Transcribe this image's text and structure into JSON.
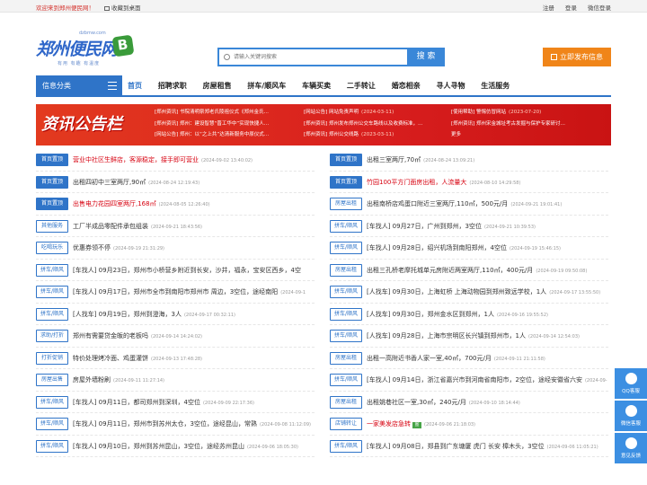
{
  "topbar": {
    "welcome": "欢迎来到郑州便民网！",
    "favorite": "收藏到桌面",
    "links": [
      "注册",
      "登录",
      "微信登录"
    ]
  },
  "logo": {
    "en": "dzbmw.com",
    "cn": "郑州便民网",
    "sub": "有用 有趣 有温度"
  },
  "search": {
    "placeholder": "请输入关键词搜索",
    "button": "搜 索"
  },
  "post_button": "立即发布信息",
  "nav": {
    "category": "信息分类",
    "items": [
      "首页",
      "招聘求职",
      "房屋租售",
      "拼车/顺风车",
      "车辆买卖",
      "二手转让",
      "婚恋相亲",
      "寻人寻物",
      "生活服务"
    ]
  },
  "notice": {
    "banner": "资讯公告栏",
    "col1": [
      {
        "t": "[郑州资讯] 书院清明祭郑老氏陵祖仪式《郑州金氏…",
        "d": ""
      },
      {
        "t": "[郑州资讯] 郑州：建设智慧“晋工华中”实现快捷人…",
        "d": ""
      },
      {
        "t": "[网站公告] 郑州：以“之上共”达清新服务中原仪式…",
        "d": ""
      }
    ],
    "col2": [
      {
        "t": "[网站公告] 网站免责声明",
        "d": "(2024-03-11)"
      },
      {
        "t": "[郑州资讯] 郑州发布郑州公交车路线以及收费标准，…",
        "d": ""
      },
      {
        "t": "[郑州资讯] 郑州公交线路",
        "d": "(2023-03-11)"
      }
    ],
    "col3": [
      {
        "t": "[使用帮助] 警惕仿冒网站",
        "d": "(2023-07-20)"
      },
      {
        "t": "[郑州资讯] 郑州宋金城址考古发掘与保护专家研讨…",
        "d": ""
      },
      {
        "t": "更多",
        "d": ""
      }
    ]
  },
  "left_list": [
    {
      "tag": "首页置顶",
      "top": true,
      "red": true,
      "text": "营业中社区生鲜店，客源稳定，接手即可营业",
      "date": "(2024-09-02 13:40:02)"
    },
    {
      "tag": "首页置顶",
      "top": true,
      "red": false,
      "text": "出租四初中三室两厅,90㎡",
      "date": "(2024-08-24 12:19:43)"
    },
    {
      "tag": "首页置顶",
      "top": true,
      "red": true,
      "text": "出售电力花园四室两厅,168㎡",
      "date": "(2024-08-05 12:26:40)"
    },
    {
      "tag": "其他服务",
      "top": false,
      "red": false,
      "text": "工厂半成品零配件承包组装",
      "date": "(2024-09-21 18:43:56)"
    },
    {
      "tag": "吃喝玩乐",
      "top": false,
      "red": false,
      "text": "优惠券领不停",
      "date": "(2024-09-19 21:31:29)"
    },
    {
      "tag": "拼车/顺风",
      "top": false,
      "red": false,
      "text": "[车找人] 09月23日，郑州市小桥营乡附近到长安，沙井，福永，宝安区西乡，4空",
      "date": ""
    },
    {
      "tag": "拼车/顺风",
      "top": false,
      "red": false,
      "text": "[车找人] 09月17日，郑州市全市到南阳市郑州市 周边，3空位，途经南阳",
      "date": "(2024-09-1"
    },
    {
      "tag": "拼车/顺风",
      "top": false,
      "red": false,
      "text": "[人找车] 09月19日，郑州到澄海，3人",
      "date": "(2024-09-17 00:32:11)"
    },
    {
      "tag": "求助/打折",
      "top": false,
      "red": false,
      "text": "郑州有需要贷金皈的老板吗",
      "date": "(2024-09-14 14:24:02)"
    },
    {
      "tag": "打折促销",
      "top": false,
      "red": false,
      "text": "特价处理烤冷面、鸡蛋灌饼",
      "date": "(2024-09-13 17:48:28)"
    },
    {
      "tag": "房屋出售",
      "top": false,
      "red": false,
      "text": "房屋外墙粉刷",
      "date": "(2024-09-11 11:27:14)"
    },
    {
      "tag": "拼车/顺风",
      "top": false,
      "red": false,
      "text": "[车找人] 09月11日，都司郑州到深圳，4空位",
      "date": "(2024-09-09 22:17:36)"
    },
    {
      "tag": "拼车/顺风",
      "top": false,
      "red": false,
      "text": "[车找人] 09月11日，郑州市到苏州太仓，3空位，途经昆山，常熟",
      "date": "(2024-09-08 11:12:09)"
    },
    {
      "tag": "拼车/顺风",
      "top": false,
      "red": false,
      "text": "[车找人] 09月10日，郑州到苏州昆山，3空位，途经苏州昆山",
      "date": "(2024-09-06 18:05:30)"
    }
  ],
  "right_list": [
    {
      "tag": "首页置顶",
      "top": true,
      "red": false,
      "pic": false,
      "text": "出租三室两厅,70㎡",
      "date": "(2024-08-24 13:09:21)"
    },
    {
      "tag": "首页置顶",
      "top": true,
      "red": true,
      "pic": false,
      "text": "竹园100平方门面房出租，人流量大",
      "date": "(2024-08-10 14:29:58)"
    },
    {
      "tag": "房屋出租",
      "top": false,
      "red": false,
      "pic": false,
      "text": "出租南桥店鸡蛋口附近三室两厅,110㎡，500元/月",
      "date": "(2024-09-21 19:01:41)"
    },
    {
      "tag": "拼车/顺风",
      "top": false,
      "red": false,
      "pic": false,
      "text": "[车找人] 09月27日，广州到郑州，3空位",
      "date": "(2024-09-21 10:39:53)"
    },
    {
      "tag": "拼车/顺风",
      "top": false,
      "red": false,
      "pic": false,
      "text": "[车找人] 09月28日，绍兴机场到南阳郑州，4空位",
      "date": "(2024-09-19 15:46:15)"
    },
    {
      "tag": "房屋出租",
      "top": false,
      "red": false,
      "pic": false,
      "text": "出租三孔桥老摩托城单元房附近两室两厅,110㎡，400元/月",
      "date": "(2024-09-19 09:50:08)"
    },
    {
      "tag": "拼车/顺风",
      "top": false,
      "red": false,
      "pic": false,
      "text": "[人找车] 09月30日，上海虹桥 上海动物园到郑州致远学校，1人",
      "date": "(2024-09-17 13:55:50)"
    },
    {
      "tag": "拼车/顺风",
      "top": false,
      "red": false,
      "pic": false,
      "text": "[人找车] 09月30日，郑州金水区到郑州，1人",
      "date": "(2024-09-16 19:55:52)"
    },
    {
      "tag": "拼车/顺风",
      "top": false,
      "red": false,
      "pic": false,
      "text": "[人找车] 09月28日，上海市宗明区长兴镇到郑州市，1人",
      "date": "(2024-09-14 12:54:03)"
    },
    {
      "tag": "房屋出租",
      "top": false,
      "red": false,
      "pic": false,
      "text": "出租一高附近书香人家一室,40㎡，700元/月",
      "date": "(2024-09-11 21:11:58)"
    },
    {
      "tag": "拼车/顺风",
      "top": false,
      "red": false,
      "pic": false,
      "text": "[车找人] 09月14日，浙江省嘉兴市到河南省南阳市，2空位，途经安徽省六安",
      "date": "(2024-09-"
    },
    {
      "tag": "房屋出租",
      "top": false,
      "red": false,
      "pic": false,
      "text": "出租姚巷社区一室,30㎡，240元/月",
      "date": "(2024-09-10 18:14:44)"
    },
    {
      "tag": "店铺转让",
      "top": false,
      "red": true,
      "pic": true,
      "text": "一家美发店急转",
      "date": "(2024-09-06 21:18:03)"
    },
    {
      "tag": "拼车/顺风",
      "top": false,
      "red": false,
      "pic": false,
      "text": "[车找人] 09月08日，郑县到广东塘厦 虎门 长安 樟木头，3空位",
      "date": "(2024-09-06 11:05:21)"
    }
  ],
  "side": [
    {
      "name": "qq",
      "label": "QQ客服"
    },
    {
      "name": "wechat",
      "label": "微信客服"
    },
    {
      "name": "feedback",
      "label": "意见反馈"
    }
  ],
  "colors": {
    "brand": "#2f74c8",
    "accent": "#f08519",
    "hot": "#d7000f"
  }
}
